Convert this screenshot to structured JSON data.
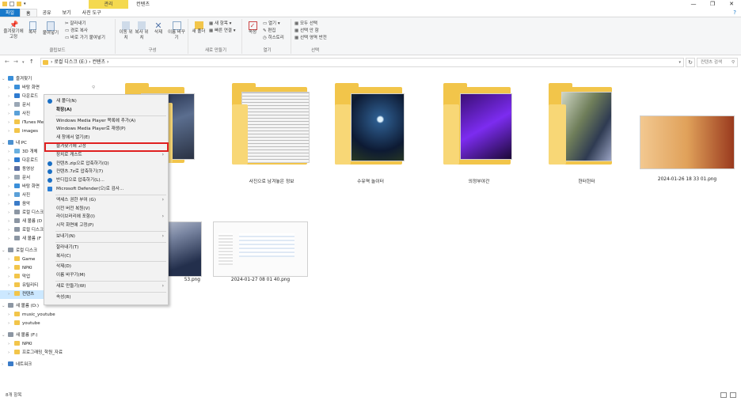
{
  "window": {
    "title": "컨텐츠",
    "context_tab": "관리",
    "controls": [
      "—",
      "❐",
      "✕"
    ]
  },
  "ribbon_tabs": [
    "파일",
    "홈",
    "공유",
    "보기",
    "사진 도구"
  ],
  "ribbon": {
    "clipboard": {
      "pin": "즐겨찾기에 고정",
      "copy": "복사",
      "paste": "붙여넣기",
      "cut": "잘라내기",
      "copy_path": "경로 복사",
      "paste_shortcut": "바로 가기 붙여넣기",
      "label": "클립보드"
    },
    "organize": {
      "move_to": "이동 위치",
      "copy_to": "복사 위치",
      "delete": "삭제",
      "rename": "이름 바꾸기",
      "label": "구성"
    },
    "new": {
      "new_folder": "새 폴더",
      "new_item": "새 항목",
      "easy_access": "빠른 연결",
      "label": "새로 만들기"
    },
    "open": {
      "properties": "속성",
      "open": "열기",
      "edit": "편집",
      "history": "히스토리",
      "label": "열기"
    },
    "select": {
      "select_all": "모두 선택",
      "select_none": "선택 안 함",
      "invert": "선택 영역 반전",
      "label": "선택"
    }
  },
  "address": {
    "crumbs": [
      "로컬 디스크 (E:)",
      "컨텐츠"
    ],
    "search_placeholder": "컨텐츠 검색"
  },
  "nav": [
    {
      "label": "즐겨찾기",
      "level": 0,
      "expanded": true,
      "icon": "star-icon"
    },
    {
      "label": "바탕 화면",
      "level": 1,
      "icon": "desktop-icon",
      "pinned": true
    },
    {
      "label": "다운로드",
      "level": 1,
      "icon": "download-icon",
      "pinned": true
    },
    {
      "label": "문서",
      "level": 1,
      "icon": "document-icon",
      "pinned": true
    },
    {
      "label": "사진",
      "level": 1,
      "icon": "picture-icon",
      "pinned": true
    },
    {
      "label": "iTunes Media",
      "level": 1,
      "icon": "folder-icon"
    },
    {
      "label": "images",
      "level": 1,
      "icon": "folder-icon"
    },
    {
      "label": "내 PC",
      "level": 0,
      "expanded": true,
      "icon": "pc-icon"
    },
    {
      "label": "3D 개체",
      "level": 1,
      "icon": "cube-icon"
    },
    {
      "label": "다운로드",
      "level": 1,
      "icon": "download-icon"
    },
    {
      "label": "동영상",
      "level": 1,
      "icon": "video-icon"
    },
    {
      "label": "문서",
      "level": 1,
      "icon": "document-icon"
    },
    {
      "label": "바탕 화면",
      "level": 1,
      "icon": "desktop-icon"
    },
    {
      "label": "사진",
      "level": 1,
      "icon": "picture-icon"
    },
    {
      "label": "음악",
      "level": 1,
      "icon": "music-icon"
    },
    {
      "label": "로컬 디스크",
      "level": 1,
      "icon": "drive-icon"
    },
    {
      "label": "새 볼륨 (D",
      "level": 1,
      "icon": "drive-icon"
    },
    {
      "label": "로컬 디스크",
      "level": 1,
      "icon": "drive-icon"
    },
    {
      "label": "새 볼륨 (F",
      "level": 1,
      "icon": "drive-icon"
    },
    {
      "label": "로컬 디스크",
      "level": 0,
      "expanded": true,
      "icon": "drive-icon"
    },
    {
      "label": "Game",
      "level": 1,
      "icon": "folder-icon"
    },
    {
      "label": "NPKI",
      "level": 1,
      "icon": "folder-icon"
    },
    {
      "label": "막업",
      "level": 1,
      "icon": "folder-icon"
    },
    {
      "label": "유틸리티",
      "level": 1,
      "icon": "folder-icon"
    },
    {
      "label": "컨텐츠",
      "level": 1,
      "icon": "folder-icon",
      "selected": true
    },
    {
      "label": "새 볼륨 (D:)",
      "level": 0,
      "expanded": true,
      "icon": "drive-icon"
    },
    {
      "label": "music_youtube",
      "level": 1,
      "icon": "folder-icon"
    },
    {
      "label": "youtube",
      "level": 1,
      "icon": "folder-icon"
    },
    {
      "label": "새 볼륨 (F:)",
      "level": 0,
      "expanded": true,
      "icon": "drive-icon"
    },
    {
      "label": "NPKI",
      "level": 1,
      "icon": "folder-icon"
    },
    {
      "label": "프로그래밍_학원_자료",
      "level": 1,
      "icon": "folder-icon"
    },
    {
      "label": "네트워크",
      "level": 0,
      "expanded": false,
      "icon": "network-icon"
    }
  ],
  "items": [
    {
      "label": "",
      "kind": "folder"
    },
    {
      "label": "사진으로 남겨놓은 정보",
      "kind": "folder"
    },
    {
      "label": "수유역 놀이터",
      "kind": "folder"
    },
    {
      "label": "의정부야간",
      "kind": "folder"
    },
    {
      "label": "헌터헌터",
      "kind": "folder"
    },
    {
      "label": "2024-01-26 18 33 01.png",
      "kind": "image"
    },
    {
      "label": "53.png",
      "kind": "image"
    },
    {
      "label": "2024-01-27 08 01 40.png",
      "kind": "image"
    }
  ],
  "context_menu": [
    {
      "label": "새 폴더(N)",
      "icon": "shield-icon"
    },
    {
      "label": "확장(A)",
      "bold": true
    },
    {
      "sep": true
    },
    {
      "label": "Windows Media Player 목록에 추가(A)"
    },
    {
      "label": "Windows Media Player로 재생(P)"
    },
    {
      "label": "새 창에서 열기(E)"
    },
    {
      "label": "즐겨찾기에 고정",
      "highlight": true
    },
    {
      "label": "장치로 캐스트",
      "submenu": true
    },
    {
      "label": "컨텐츠.zip으로 압축하기(Q)",
      "icon": "zip-icon"
    },
    {
      "label": "컨텐츠.7z로 압축하기(7)",
      "icon": "zip-icon"
    },
    {
      "label": "반디집으로 압축하기(L)...",
      "icon": "zip-icon"
    },
    {
      "label": "Microsoft Defender(으)로 검사...",
      "icon": "defender-icon"
    },
    {
      "sep": true
    },
    {
      "label": "액세스 권한 부여 (G)",
      "submenu": true
    },
    {
      "label": "이전 버전 복원(V)"
    },
    {
      "label": "라이브러리에 포함(I)",
      "submenu": true
    },
    {
      "label": "시작 화면에 고정(P)"
    },
    {
      "sep": true
    },
    {
      "label": "보내기(N)",
      "submenu": true
    },
    {
      "sep": true
    },
    {
      "label": "잘라내기(T)"
    },
    {
      "label": "복사(C)"
    },
    {
      "sep": true
    },
    {
      "label": "삭제(D)"
    },
    {
      "label": "이름 바꾸기(M)"
    },
    {
      "sep": true
    },
    {
      "label": "새로 만들기(W)",
      "submenu": true
    },
    {
      "sep": true
    },
    {
      "label": "속성(R)"
    }
  ],
  "status": {
    "count": "8개 항목"
  },
  "colors": {
    "accent": "#1979ca",
    "folder": "#f2c54a",
    "manage_tab": "#f4d94f",
    "highlight_box": "#e02020",
    "selected": "#cce8ff"
  }
}
